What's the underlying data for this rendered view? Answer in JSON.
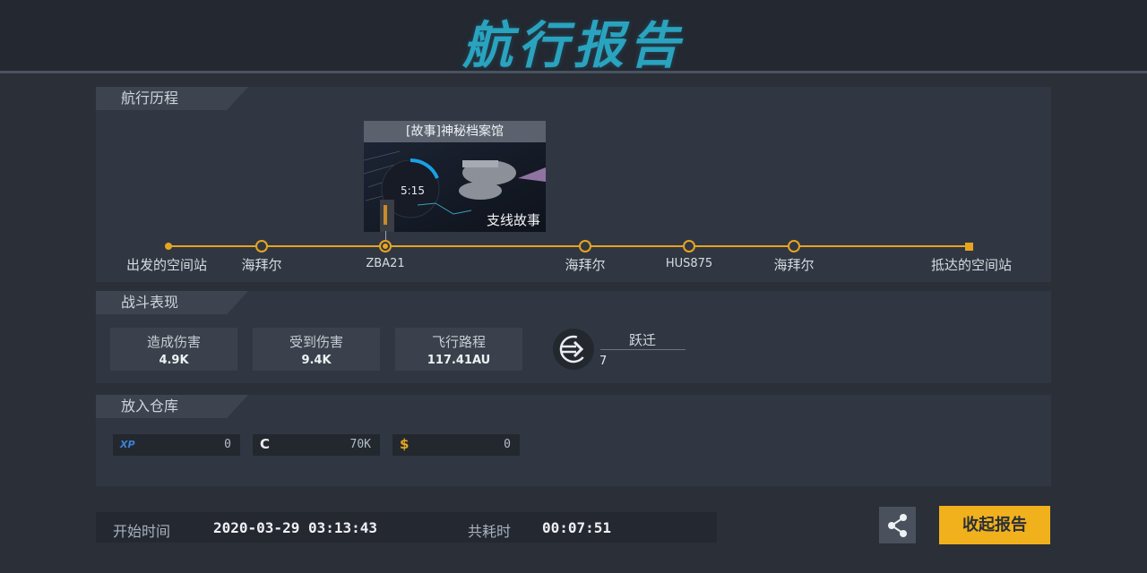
{
  "header": {
    "title": "航行报告"
  },
  "voyage": {
    "section_label": "航行历程",
    "stops": [
      {
        "label": "出发的空间站",
        "type": "start"
      },
      {
        "label": "海拜尔",
        "type": "stop"
      },
      {
        "label": "ZBA21",
        "type": "active"
      },
      {
        "label": "海拜尔",
        "type": "stop"
      },
      {
        "label": "HUS875",
        "type": "stop"
      },
      {
        "label": "海拜尔",
        "type": "stop"
      },
      {
        "label": "抵达的空间站",
        "type": "end"
      }
    ],
    "story": {
      "title": "[故事]神秘档案馆",
      "timer": "5:15",
      "tag": "支线故事"
    }
  },
  "combat": {
    "section_label": "战斗表现",
    "stats": [
      {
        "label": "造成伤害",
        "value": "4.9K"
      },
      {
        "label": "受到伤害",
        "value": "9.4K"
      },
      {
        "label": "飞行路程",
        "value": "117.41AU"
      }
    ],
    "warp": {
      "label": "跃迁",
      "value": "7"
    }
  },
  "storage": {
    "section_label": "放入仓库",
    "resources": [
      {
        "icon": "xp-icon",
        "symbol": "XP",
        "value": "0",
        "color": "#3b7fd6"
      },
      {
        "icon": "credits-icon",
        "symbol": "C",
        "value": "70K",
        "color": "#e8ecef"
      },
      {
        "icon": "dollar-icon",
        "symbol": "$",
        "value": "0",
        "color": "#e6a520"
      }
    ]
  },
  "footer": {
    "start_label": "开始时间",
    "start_value": "2020-03-29 03:13:43",
    "duration_label": "共耗时",
    "duration_value": "00:07:51"
  },
  "actions": {
    "collect_label": "收起报告"
  },
  "colors": {
    "accent": "#e6a520",
    "title": "#2aa3bf",
    "button": "#f0b11c"
  }
}
